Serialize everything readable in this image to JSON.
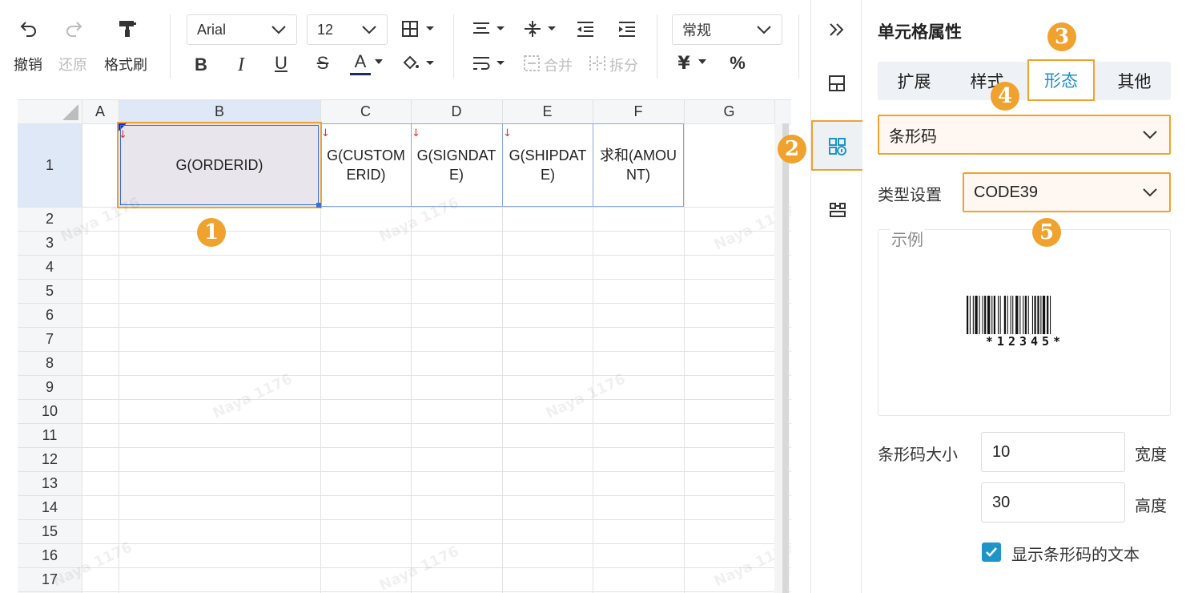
{
  "toolbar": {
    "undo_label": "撤销",
    "redo_label": "还原",
    "format_painter_label": "格式刷",
    "font_family": "Arial",
    "font_size": "12",
    "merge_label": "合并",
    "split_label": "拆分",
    "number_format": "常规",
    "currency_symbol": "¥",
    "percent_symbol": "%",
    "bold": "B",
    "italic": "I",
    "underline": "U",
    "strike": "S",
    "font_color": "A"
  },
  "grid": {
    "columns": [
      "A",
      "B",
      "C",
      "D",
      "E",
      "F",
      "G"
    ],
    "rows": [
      "1",
      "2",
      "3",
      "4",
      "5",
      "6",
      "7",
      "8",
      "9",
      "10",
      "11",
      "12",
      "13",
      "14",
      "15",
      "16",
      "17"
    ],
    "cells": {
      "B1": "G(ORDERID)",
      "C1": "G(CUSTOMERID)",
      "D1": "G(SIGNDATE)",
      "E1": "G(SHIPDATE)",
      "F1": "求和(AMOUNT)"
    },
    "expand_arrow": "↓",
    "watermark": "Naya 1176"
  },
  "panel": {
    "title": "单元格属性",
    "tabs": [
      "扩展",
      "样式",
      "形态",
      "其他"
    ],
    "active_tab": "形态",
    "display_type": "条形码",
    "type_setting_label": "类型设置",
    "type_setting_value": "CODE39",
    "example_label": "示例",
    "barcode_text": "*12345*",
    "size_label": "条形码大小",
    "width_value": "10",
    "width_label": "宽度",
    "height_value": "30",
    "height_label": "高度",
    "show_text_label": "显示条形码的文本",
    "show_text_checked": true
  },
  "markers": [
    "1",
    "2",
    "3",
    "4",
    "5"
  ],
  "colors": {
    "accent_orange": "#f0a22e",
    "accent_blue": "#1e8fc8",
    "selection_blue": "#3c6fd1"
  }
}
